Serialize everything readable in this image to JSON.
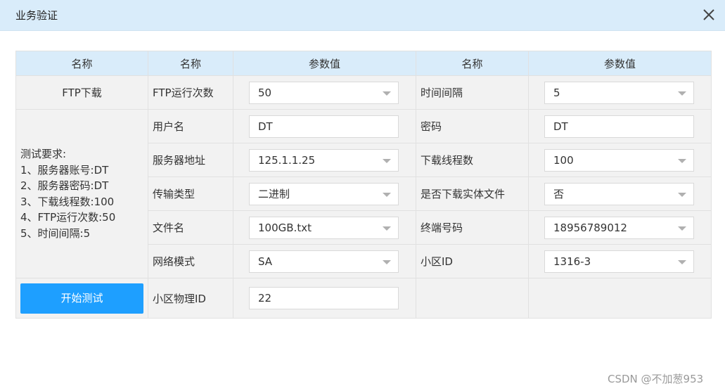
{
  "dialog": {
    "title": "业务验证"
  },
  "table": {
    "headers": [
      "名称",
      "名称",
      "参数值",
      "名称",
      "参数值"
    ],
    "section1": "FTP下载",
    "requirements": {
      "title": "测试要求:",
      "items": [
        "1、服务器账号:DT",
        "2、服务器密码:DT",
        "3、下载线程数:100",
        "4、FTP运行次数:50",
        "5、时间间隔:5"
      ]
    },
    "rows": [
      {
        "l_label": "FTP运行次数",
        "l_value": "50",
        "r_label": "时间间隔",
        "r_value": "5"
      },
      {
        "l_label": "用户名",
        "l_value": "DT",
        "r_label": "密码",
        "r_value": "DT"
      },
      {
        "l_label": "服务器地址",
        "l_value": "125.1.1.25",
        "r_label": "下载线程数",
        "r_value": "100"
      },
      {
        "l_label": "传输类型",
        "l_value": "二进制",
        "r_label": "是否下载实体文件",
        "r_value": "否"
      },
      {
        "l_label": "文件名",
        "l_value": "100GB.txt",
        "r_label": "终端号码",
        "r_value": "18956789012"
      },
      {
        "l_label": "网络模式",
        "l_value": "SA",
        "r_label": "小区ID",
        "r_value": "1316-3"
      },
      {
        "l_label": "小区物理ID",
        "l_value": "22"
      }
    ],
    "start_button": "开始测试"
  },
  "watermark": "CSDN @不加葱953",
  "colors": {
    "header_bg": "#d9ecfa",
    "button": "#1e9fff",
    "cell_bg": "#f2f2f2"
  }
}
